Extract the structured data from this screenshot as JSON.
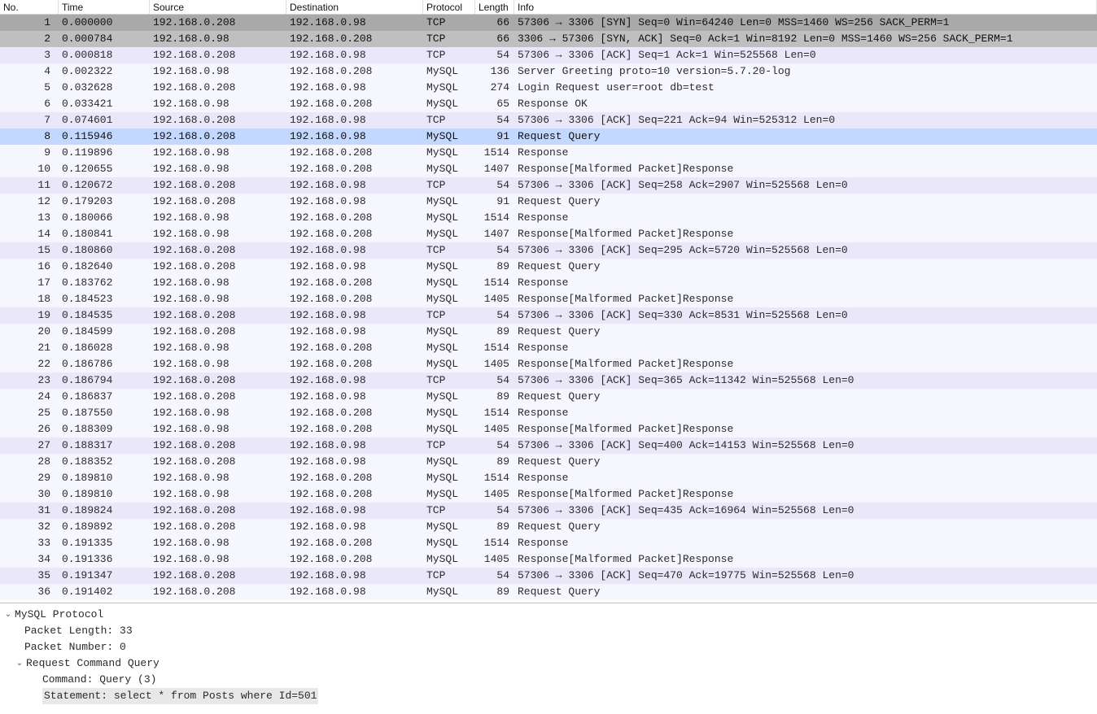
{
  "headers": {
    "no": "No.",
    "time": "Time",
    "source": "Source",
    "destination": "Destination",
    "protocol": "Protocol",
    "length": "Length",
    "info": "Info"
  },
  "packets": [
    {
      "no": "1",
      "time": "0.000000",
      "src": "192.168.0.208",
      "dst": "192.168.0.98",
      "proto": "TCP",
      "len": "66",
      "info": "57306 → 3306 [SYN] Seq=0 Win=64240 Len=0 MSS=1460 WS=256 SACK_PERM=1",
      "cls": "gray1"
    },
    {
      "no": "2",
      "time": "0.000784",
      "src": "192.168.0.98",
      "dst": "192.168.0.208",
      "proto": "TCP",
      "len": "66",
      "info": "3306 → 57306 [SYN, ACK] Seq=0 Ack=1 Win=8192 Len=0 MSS=1460 WS=256 SACK_PERM=1",
      "cls": "gray2"
    },
    {
      "no": "3",
      "time": "0.000818",
      "src": "192.168.0.208",
      "dst": "192.168.0.98",
      "proto": "TCP",
      "len": "54",
      "info": "57306 → 3306 [ACK] Seq=1 Ack=1 Win=525568 Len=0",
      "cls": "lav"
    },
    {
      "no": "4",
      "time": "0.002322",
      "src": "192.168.0.98",
      "dst": "192.168.0.208",
      "proto": "MySQL",
      "len": "136",
      "info": "Server Greeting proto=10 version=5.7.20-log",
      "cls": "lite"
    },
    {
      "no": "5",
      "time": "0.032628",
      "src": "192.168.0.208",
      "dst": "192.168.0.98",
      "proto": "MySQL",
      "len": "274",
      "info": "Login Request user=root db=test",
      "cls": "lite"
    },
    {
      "no": "6",
      "time": "0.033421",
      "src": "192.168.0.98",
      "dst": "192.168.0.208",
      "proto": "MySQL",
      "len": "65",
      "info": "Response OK",
      "cls": "lite"
    },
    {
      "no": "7",
      "time": "0.074601",
      "src": "192.168.0.208",
      "dst": "192.168.0.98",
      "proto": "TCP",
      "len": "54",
      "info": "57306 → 3306 [ACK] Seq=221 Ack=94 Win=525312 Len=0",
      "cls": "lav"
    },
    {
      "no": "8",
      "time": "0.115946",
      "src": "192.168.0.208",
      "dst": "192.168.0.98",
      "proto": "MySQL",
      "len": "91",
      "info": "Request Query",
      "cls": "sel"
    },
    {
      "no": "9",
      "time": "0.119896",
      "src": "192.168.0.98",
      "dst": "192.168.0.208",
      "proto": "MySQL",
      "len": "1514",
      "info": "Response",
      "cls": "lite"
    },
    {
      "no": "10",
      "time": "0.120655",
      "src": "192.168.0.98",
      "dst": "192.168.0.208",
      "proto": "MySQL",
      "len": "1407",
      "info": "Response[Malformed Packet]Response",
      "cls": "lite"
    },
    {
      "no": "11",
      "time": "0.120672",
      "src": "192.168.0.208",
      "dst": "192.168.0.98",
      "proto": "TCP",
      "len": "54",
      "info": "57306 → 3306 [ACK] Seq=258 Ack=2907 Win=525568 Len=0",
      "cls": "lav"
    },
    {
      "no": "12",
      "time": "0.179203",
      "src": "192.168.0.208",
      "dst": "192.168.0.98",
      "proto": "MySQL",
      "len": "91",
      "info": "Request Query",
      "cls": "lite"
    },
    {
      "no": "13",
      "time": "0.180066",
      "src": "192.168.0.98",
      "dst": "192.168.0.208",
      "proto": "MySQL",
      "len": "1514",
      "info": "Response",
      "cls": "lite"
    },
    {
      "no": "14",
      "time": "0.180841",
      "src": "192.168.0.98",
      "dst": "192.168.0.208",
      "proto": "MySQL",
      "len": "1407",
      "info": "Response[Malformed Packet]Response",
      "cls": "lite"
    },
    {
      "no": "15",
      "time": "0.180860",
      "src": "192.168.0.208",
      "dst": "192.168.0.98",
      "proto": "TCP",
      "len": "54",
      "info": "57306 → 3306 [ACK] Seq=295 Ack=5720 Win=525568 Len=0",
      "cls": "lav"
    },
    {
      "no": "16",
      "time": "0.182640",
      "src": "192.168.0.208",
      "dst": "192.168.0.98",
      "proto": "MySQL",
      "len": "89",
      "info": "Request Query",
      "cls": "lite"
    },
    {
      "no": "17",
      "time": "0.183762",
      "src": "192.168.0.98",
      "dst": "192.168.0.208",
      "proto": "MySQL",
      "len": "1514",
      "info": "Response",
      "cls": "lite"
    },
    {
      "no": "18",
      "time": "0.184523",
      "src": "192.168.0.98",
      "dst": "192.168.0.208",
      "proto": "MySQL",
      "len": "1405",
      "info": "Response[Malformed Packet]Response",
      "cls": "lite"
    },
    {
      "no": "19",
      "time": "0.184535",
      "src": "192.168.0.208",
      "dst": "192.168.0.98",
      "proto": "TCP",
      "len": "54",
      "info": "57306 → 3306 [ACK] Seq=330 Ack=8531 Win=525568 Len=0",
      "cls": "lav"
    },
    {
      "no": "20",
      "time": "0.184599",
      "src": "192.168.0.208",
      "dst": "192.168.0.98",
      "proto": "MySQL",
      "len": "89",
      "info": "Request Query",
      "cls": "lite"
    },
    {
      "no": "21",
      "time": "0.186028",
      "src": "192.168.0.98",
      "dst": "192.168.0.208",
      "proto": "MySQL",
      "len": "1514",
      "info": "Response",
      "cls": "lite"
    },
    {
      "no": "22",
      "time": "0.186786",
      "src": "192.168.0.98",
      "dst": "192.168.0.208",
      "proto": "MySQL",
      "len": "1405",
      "info": "Response[Malformed Packet]Response",
      "cls": "lite"
    },
    {
      "no": "23",
      "time": "0.186794",
      "src": "192.168.0.208",
      "dst": "192.168.0.98",
      "proto": "TCP",
      "len": "54",
      "info": "57306 → 3306 [ACK] Seq=365 Ack=11342 Win=525568 Len=0",
      "cls": "lav"
    },
    {
      "no": "24",
      "time": "0.186837",
      "src": "192.168.0.208",
      "dst": "192.168.0.98",
      "proto": "MySQL",
      "len": "89",
      "info": "Request Query",
      "cls": "lite"
    },
    {
      "no": "25",
      "time": "0.187550",
      "src": "192.168.0.98",
      "dst": "192.168.0.208",
      "proto": "MySQL",
      "len": "1514",
      "info": "Response",
      "cls": "lite"
    },
    {
      "no": "26",
      "time": "0.188309",
      "src": "192.168.0.98",
      "dst": "192.168.0.208",
      "proto": "MySQL",
      "len": "1405",
      "info": "Response[Malformed Packet]Response",
      "cls": "lite"
    },
    {
      "no": "27",
      "time": "0.188317",
      "src": "192.168.0.208",
      "dst": "192.168.0.98",
      "proto": "TCP",
      "len": "54",
      "info": "57306 → 3306 [ACK] Seq=400 Ack=14153 Win=525568 Len=0",
      "cls": "lav"
    },
    {
      "no": "28",
      "time": "0.188352",
      "src": "192.168.0.208",
      "dst": "192.168.0.98",
      "proto": "MySQL",
      "len": "89",
      "info": "Request Query",
      "cls": "lite"
    },
    {
      "no": "29",
      "time": "0.189810",
      "src": "192.168.0.98",
      "dst": "192.168.0.208",
      "proto": "MySQL",
      "len": "1514",
      "info": "Response",
      "cls": "lite"
    },
    {
      "no": "30",
      "time": "0.189810",
      "src": "192.168.0.98",
      "dst": "192.168.0.208",
      "proto": "MySQL",
      "len": "1405",
      "info": "Response[Malformed Packet]Response",
      "cls": "lite"
    },
    {
      "no": "31",
      "time": "0.189824",
      "src": "192.168.0.208",
      "dst": "192.168.0.98",
      "proto": "TCP",
      "len": "54",
      "info": "57306 → 3306 [ACK] Seq=435 Ack=16964 Win=525568 Len=0",
      "cls": "lav"
    },
    {
      "no": "32",
      "time": "0.189892",
      "src": "192.168.0.208",
      "dst": "192.168.0.98",
      "proto": "MySQL",
      "len": "89",
      "info": "Request Query",
      "cls": "lite"
    },
    {
      "no": "33",
      "time": "0.191335",
      "src": "192.168.0.98",
      "dst": "192.168.0.208",
      "proto": "MySQL",
      "len": "1514",
      "info": "Response",
      "cls": "lite"
    },
    {
      "no": "34",
      "time": "0.191336",
      "src": "192.168.0.98",
      "dst": "192.168.0.208",
      "proto": "MySQL",
      "len": "1405",
      "info": "Response[Malformed Packet]Response",
      "cls": "lite"
    },
    {
      "no": "35",
      "time": "0.191347",
      "src": "192.168.0.208",
      "dst": "192.168.0.98",
      "proto": "TCP",
      "len": "54",
      "info": "57306 → 3306 [ACK] Seq=470 Ack=19775 Win=525568 Len=0",
      "cls": "lav"
    },
    {
      "no": "36",
      "time": "0.191402",
      "src": "192.168.0.208",
      "dst": "192.168.0.98",
      "proto": "MySQL",
      "len": "89",
      "info": "Request Query",
      "cls": "lite"
    }
  ],
  "detail": {
    "protocol_label": "MySQL Protocol",
    "packet_length_label": "Packet Length: 33",
    "packet_number_label": "Packet Number: 0",
    "request_label": "Request Command Query",
    "command_label": "Command: Query (3)",
    "statement_label": "Statement: select * from Posts where Id=501"
  }
}
